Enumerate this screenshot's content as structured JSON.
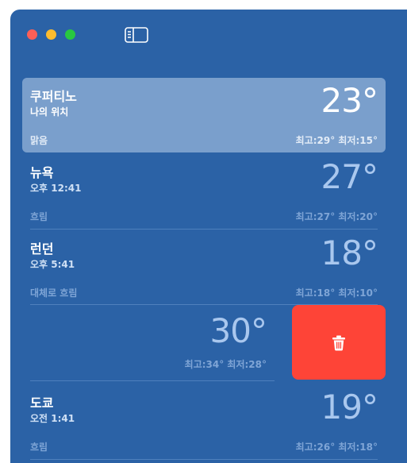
{
  "cities": [
    {
      "name": "쿠퍼티노",
      "subtitle": "나의 위치",
      "temp": "23°",
      "condition": "맑음",
      "hilo": "최고:29° 최저:15°",
      "selected": true
    },
    {
      "name": "뉴욕",
      "subtitle": "오후 12:41",
      "temp": "27°",
      "condition": "흐림",
      "hilo": "최고:27° 최저:20°"
    },
    {
      "name": "런던",
      "subtitle": "오후 5:41",
      "temp": "18°",
      "condition": "대체로 흐림",
      "hilo": "최고:18° 최저:10°"
    },
    {
      "temp": "30°",
      "hilo": "최고:34° 최저:28°",
      "swiped": true
    },
    {
      "name": "도쿄",
      "subtitle": "오전 1:41",
      "temp": "19°",
      "condition": "흐림",
      "hilo": "최고:26° 최저:18°"
    }
  ],
  "delete_action": {
    "icon": "trash-icon",
    "color": "#fe4437"
  },
  "colors": {
    "window_bg": "#2b62a6",
    "selected_bg": "#7a9fcc"
  }
}
